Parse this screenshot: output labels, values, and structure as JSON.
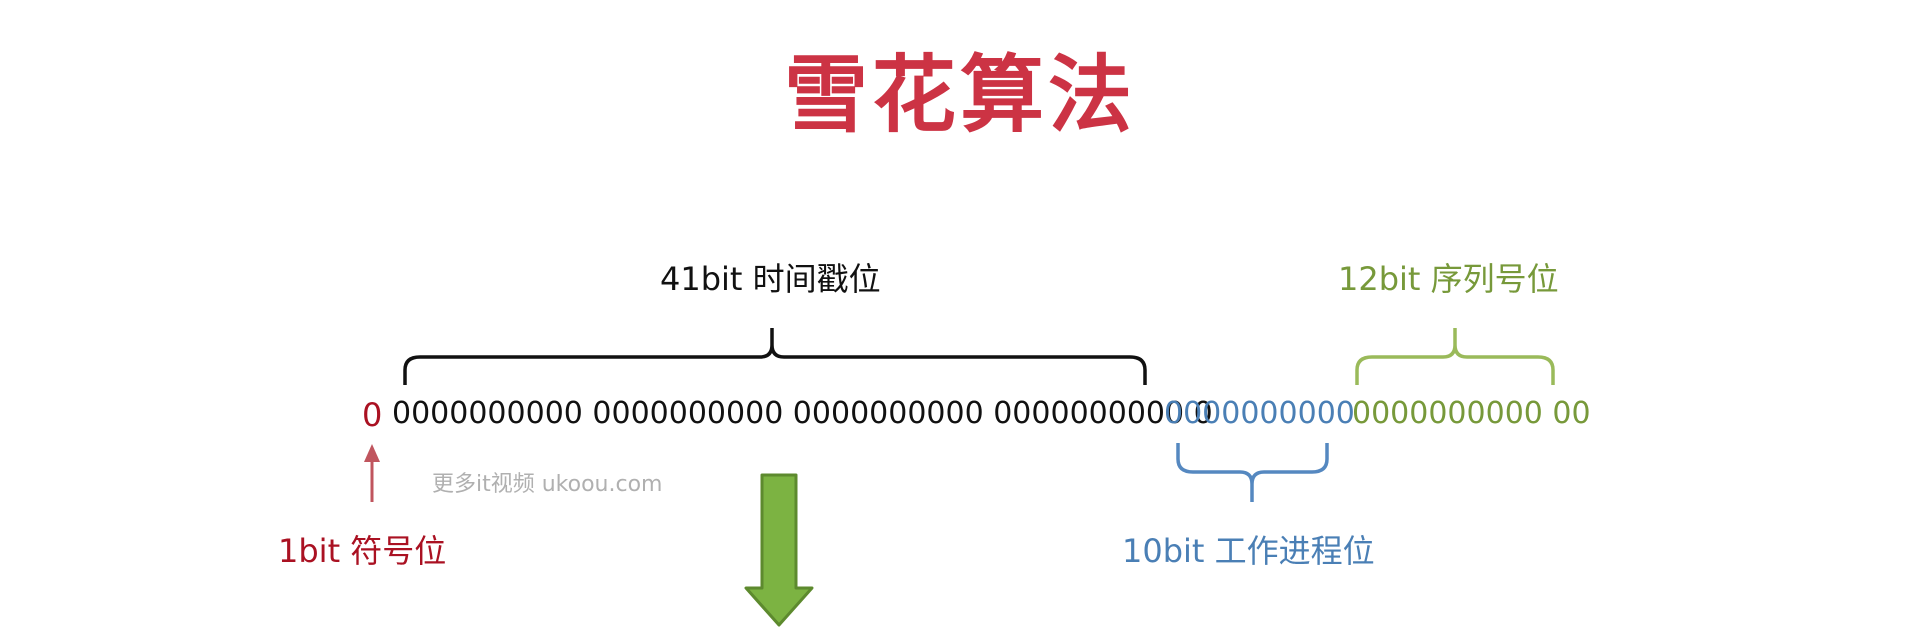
{
  "title": "雪花算法",
  "sign": {
    "bits": "0",
    "label": "1bit 符号位",
    "color": "#aa1122"
  },
  "timestamp": {
    "bits": "0000000000 0000000000 0000000000 0000000000 0",
    "label": "41bit 时间戳位",
    "color": "#111111"
  },
  "worker": {
    "bits": "0000000000",
    "label": "10bit 工作进程位",
    "color": "#4a7fb5"
  },
  "sequence": {
    "bits": "0000000000 00",
    "label": "12bit 序列号位",
    "color": "#77993a"
  },
  "watermark": "更多it视频 ukoou.com",
  "arrow_color": "#7cb342"
}
